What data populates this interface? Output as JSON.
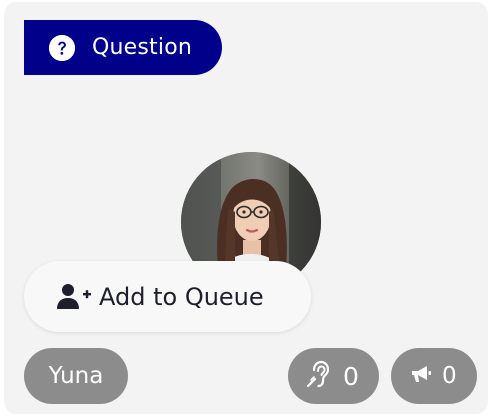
{
  "card": {
    "tag": {
      "label": "Question",
      "icon": "question-circle-icon",
      "color": "#00008b"
    },
    "avatar": {
      "alt": "Yuna profile photo"
    },
    "queue_button": {
      "label": "Add to Queue",
      "icon": "user-plus-icon"
    },
    "name": "Yuna",
    "hearing": {
      "icon": "hearing-assistance-icon",
      "count": "0"
    },
    "announcements": {
      "icon": "megaphone-icon",
      "count": "0"
    },
    "colors": {
      "card_background": "#f3f3f3",
      "pill_background": "#8c8c8c"
    }
  }
}
